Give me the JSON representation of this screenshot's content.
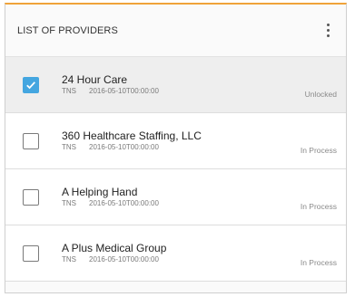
{
  "header": {
    "title": "LIST OF PROVIDERS",
    "menu_icon": "kebab-menu-icon"
  },
  "providers": [
    {
      "name": "24 Hour Care",
      "type": "TNS",
      "date": "2016-05-10T00:00:00",
      "status": "Unlocked",
      "checked": true
    },
    {
      "name": "360 Healthcare Staffing, LLC",
      "type": "TNS",
      "date": "2016-05-10T00:00:00",
      "status": "In Process",
      "checked": false
    },
    {
      "name": "A Helping Hand",
      "type": "TNS",
      "date": "2016-05-10T00:00:00",
      "status": "In Process",
      "checked": false
    },
    {
      "name": "A Plus Medical Group",
      "type": "TNS",
      "date": "2016-05-10T00:00:00",
      "status": "In Process",
      "checked": false
    }
  ],
  "colors": {
    "accent_top_border": "#f0a33a",
    "checkbox_checked": "#44a6e0",
    "selected_row": "#eeeeee"
  }
}
